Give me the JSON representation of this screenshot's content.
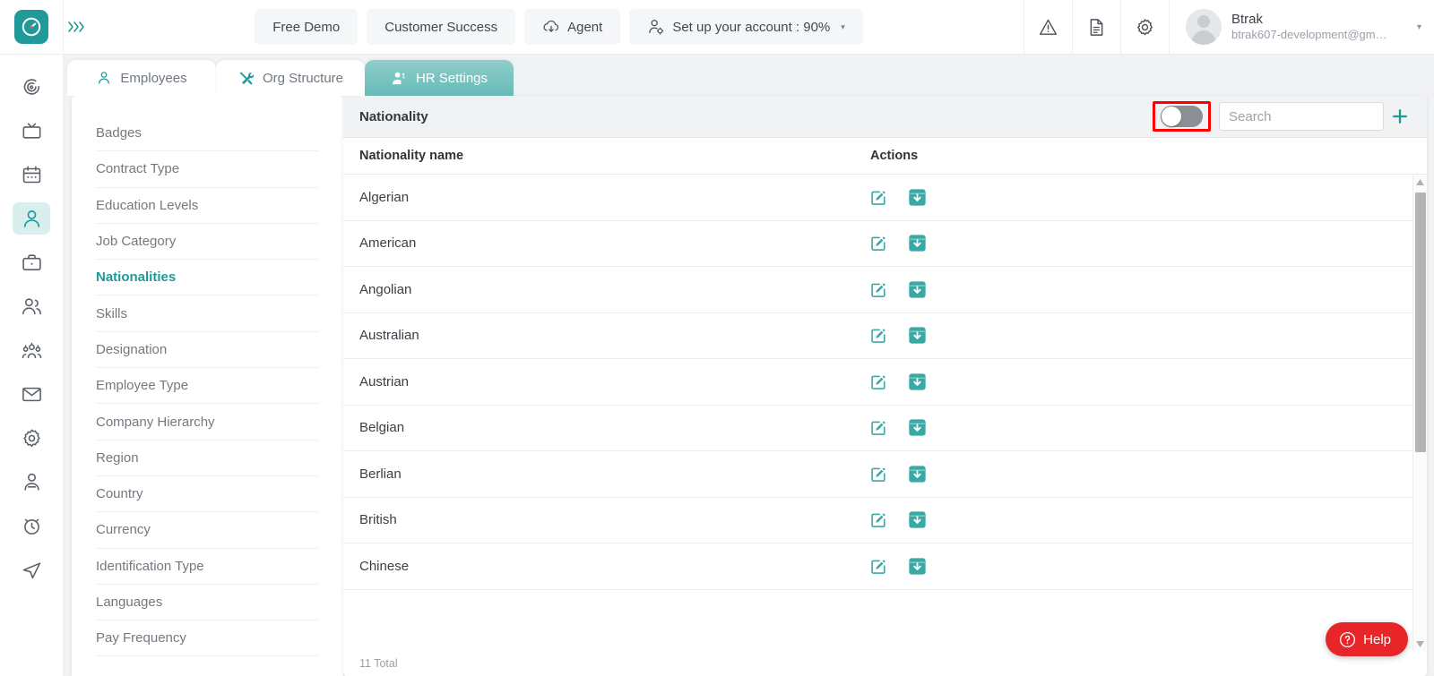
{
  "topbar": {
    "logo_icon": "clock-dial-logo",
    "expand_icon": "chevrons-right-icon",
    "expand_glyph": "»›",
    "buttons": [
      {
        "label": "Free Demo",
        "name": "free-demo-button",
        "icon": null
      },
      {
        "label": "Customer Success",
        "name": "customer-success-button",
        "icon": null
      },
      {
        "label": "Agent",
        "name": "agent-button",
        "icon": "cloud-download-icon"
      }
    ],
    "setup_account": {
      "label": "Set up your account : 90%",
      "icon": "user-gear-icon",
      "caret": "▾"
    },
    "icons": [
      {
        "name": "warning-triangle-icon"
      },
      {
        "name": "document-icon"
      },
      {
        "name": "gear-icon"
      }
    ],
    "profile": {
      "name": "Btrak",
      "email": "btrak607-development@gm…",
      "caret": "▾",
      "avatar_icon": "avatar-placeholder-icon"
    }
  },
  "rail": {
    "items": [
      {
        "name": "rail-item-dashboard",
        "icon": "target-spiral-icon",
        "active": false
      },
      {
        "name": "rail-item-media",
        "icon": "tv-icon",
        "active": false
      },
      {
        "name": "rail-item-calendar",
        "icon": "calendar-icon",
        "active": false
      },
      {
        "name": "rail-item-employees",
        "icon": "user-icon",
        "active": true
      },
      {
        "name": "rail-item-jobs",
        "icon": "briefcase-icon",
        "active": false
      },
      {
        "name": "rail-item-teams",
        "icon": "users-icon",
        "active": false
      },
      {
        "name": "rail-item-org",
        "icon": "org-group-icon",
        "active": false
      },
      {
        "name": "rail-item-mail",
        "icon": "envelope-icon",
        "active": false
      },
      {
        "name": "rail-item-settings",
        "icon": "gear-icon",
        "active": false
      },
      {
        "name": "rail-item-profile",
        "icon": "person-badge-icon",
        "active": false
      },
      {
        "name": "rail-item-time",
        "icon": "alarm-clock-icon",
        "active": false
      },
      {
        "name": "rail-item-send",
        "icon": "paper-plane-icon",
        "active": false
      }
    ]
  },
  "tabs": [
    {
      "label": "Employees",
      "icon": "user-outline-icon",
      "active": false
    },
    {
      "label": "Org Structure",
      "icon": "tools-icon",
      "active": false
    },
    {
      "label": "HR Settings",
      "icon": "user-settings-icon",
      "active": true
    }
  ],
  "settings_menu": {
    "items": [
      {
        "label": "Badges",
        "active": false
      },
      {
        "label": "Contract Type",
        "active": false
      },
      {
        "label": "Education Levels",
        "active": false
      },
      {
        "label": "Job Category",
        "active": false
      },
      {
        "label": "Nationalities",
        "active": true
      },
      {
        "label": "Skills",
        "active": false
      },
      {
        "label": "Designation",
        "active": false
      },
      {
        "label": "Employee Type",
        "active": false
      },
      {
        "label": "Company Hierarchy",
        "active": false
      },
      {
        "label": "Region",
        "active": false
      },
      {
        "label": "Country",
        "active": false
      },
      {
        "label": "Currency",
        "active": false
      },
      {
        "label": "Identification Type",
        "active": false
      },
      {
        "label": "Languages",
        "active": false
      },
      {
        "label": "Pay Frequency",
        "active": false
      }
    ]
  },
  "panel": {
    "title": "Nationality",
    "toggle": {
      "name": "archive-toggle",
      "state": "off",
      "highlighted": true
    },
    "search": {
      "placeholder": "Search",
      "value": ""
    },
    "add_button": {
      "glyph": "+",
      "name": "add-nationality-button"
    },
    "columns": [
      "Nationality name",
      "Actions"
    ],
    "rows": [
      {
        "name": "Algerian"
      },
      {
        "name": "American"
      },
      {
        "name": "Angolian"
      },
      {
        "name": "Australian"
      },
      {
        "name": "Austrian"
      },
      {
        "name": "Belgian"
      },
      {
        "name": "Berlian"
      },
      {
        "name": "British"
      },
      {
        "name": "Chinese"
      }
    ],
    "row_actions": [
      {
        "name": "edit-icon",
        "type": "edit"
      },
      {
        "name": "archive-down-icon",
        "type": "archive"
      }
    ],
    "footer_total": "11 Total",
    "scrollbar": {
      "up_glyph": "▲",
      "down_glyph": "▼"
    }
  },
  "help": {
    "label": "Help",
    "icon": "question-circle-icon"
  },
  "colors": {
    "brand_teal": "#1f9a98",
    "active_tab_top": "#8fcecb",
    "active_tab_bottom": "#66bab7",
    "help_red": "#e8262a",
    "highlight_red": "#ff0000",
    "toggle_off": "#8b9097"
  }
}
